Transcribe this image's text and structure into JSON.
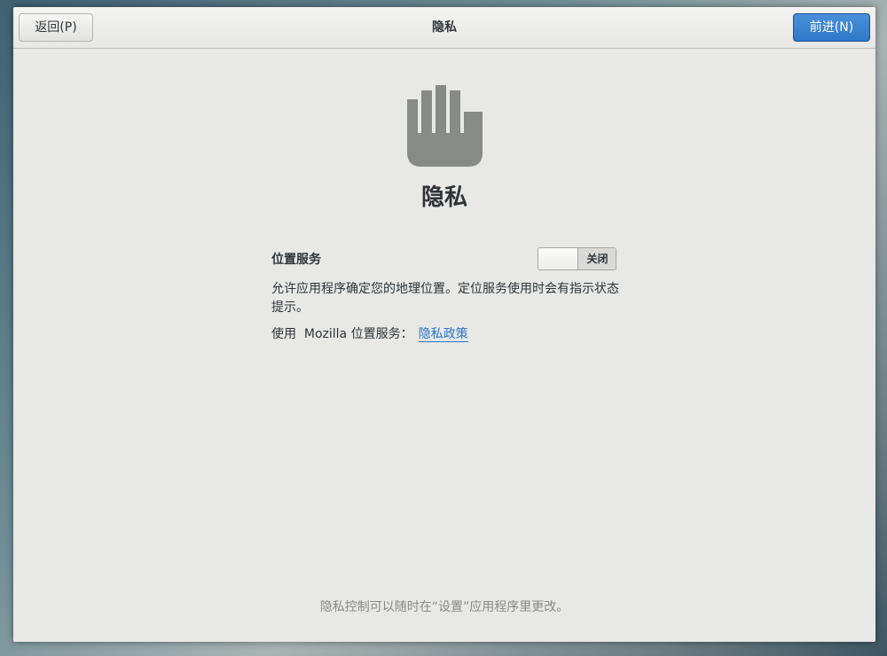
{
  "header": {
    "back_label": "返回(P)",
    "title": "隐私",
    "next_label": "前进(N)"
  },
  "page": {
    "icon": "hand-stop-icon",
    "title": "隐私"
  },
  "location": {
    "label": "位置服务",
    "switch_state": "关闭",
    "description": "允许应用程序确定您的地理位置。定位服务使用时会有指示状态提示。",
    "provider_prefix": "使用  Mozilla 位置服务：",
    "policy_link": "隐私政策"
  },
  "footer": {
    "note": "隐私控制可以随时在“设置”应用程序里更改。"
  },
  "colors": {
    "accent": "#2e78c8",
    "icon": "#888a85",
    "link": "#2a76c6"
  }
}
